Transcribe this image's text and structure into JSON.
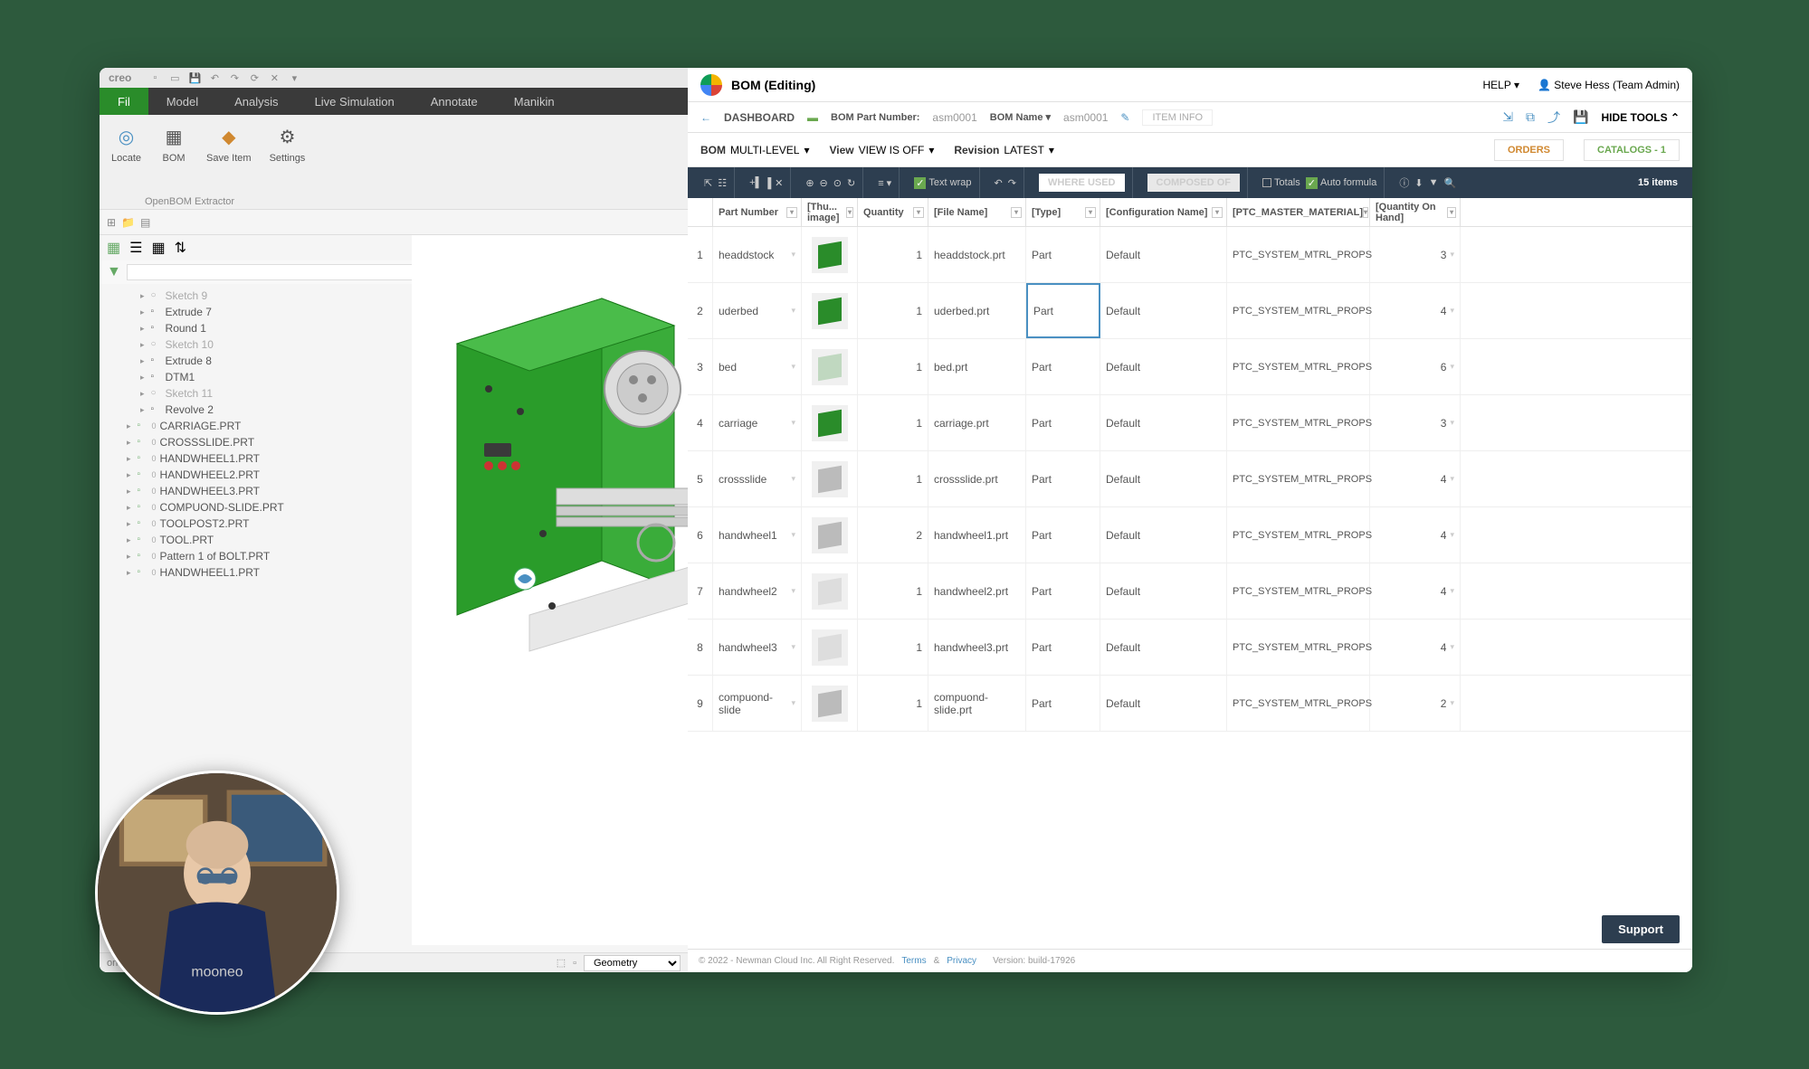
{
  "creo": {
    "logo": "creo",
    "tabs": [
      "Fil",
      "Model",
      "Analysis",
      "Live Simulation",
      "Annotate",
      "Manikin"
    ],
    "active_tab": 0,
    "ribbon": [
      {
        "label": "Locate",
        "icon": "◎"
      },
      {
        "label": "BOM",
        "icon": "▦"
      },
      {
        "label": "Save Item",
        "icon": "◆"
      },
      {
        "label": "Settings",
        "icon": "⚙"
      }
    ],
    "ribbon_group": "OpenBOM Extractor",
    "tree_features": [
      {
        "label": "Sketch 9",
        "type": "sketch"
      },
      {
        "label": "Extrude 7",
        "type": "feature"
      },
      {
        "label": "Round 1",
        "type": "feature"
      },
      {
        "label": "Sketch 10",
        "type": "sketch"
      },
      {
        "label": "Extrude 8",
        "type": "feature"
      },
      {
        "label": "DTM1",
        "type": "feature"
      },
      {
        "label": "Sketch 11",
        "type": "sketch"
      },
      {
        "label": "Revolve 2",
        "type": "feature"
      }
    ],
    "tree_parts": [
      "CARRIAGE.PRT",
      "CROSSSLIDE.PRT",
      "HANDWHEEL1.PRT",
      "HANDWHEEL2.PRT",
      "HANDWHEEL3.PRT",
      "COMPUOND-SLIDE.PRT",
      "TOOLPOST2.PRT",
      "TOOL.PRT",
      "Pattern 1 of BOLT.PRT",
      "HANDWHEEL1.PRT"
    ],
    "status": "on saved",
    "geometry": "Geometry"
  },
  "openbom": {
    "title": "BOM (Editing)",
    "help": "HELP",
    "user": "Steve Hess (Team Admin)",
    "dashboard": "DASHBOARD",
    "bom_pn_label": "BOM Part Number:",
    "bom_pn_value": "asm0001",
    "bom_name_label": "BOM Name",
    "bom_name_value": "asm0001",
    "item_info": "ITEM INFO",
    "hide_tools": "HIDE TOOLS",
    "bom_label": "BOM",
    "multi_level": "MULTI-LEVEL",
    "view_label": "View",
    "view_is_off": "VIEW IS OFF",
    "revision_label": "Revision",
    "latest": "LATEST",
    "orders": "ORDERS",
    "catalogs": "CATALOGS - 1",
    "text_wrap": "Text wrap",
    "where_used": "WHERE USED",
    "composed_of": "COMPOSED OF",
    "totals": "Totals",
    "auto_formula": "Auto formula",
    "items_count": "15 items",
    "columns": [
      "Part Number",
      "[Thu... image]",
      "Quantity",
      "[File Name]",
      "[Type]",
      "[Configuration Name]",
      "[PTC_MASTER_MATERIAL]",
      "[Quantity On Hand]"
    ],
    "rows": [
      {
        "idx": "1",
        "pn": "headdstock",
        "qty": "1",
        "fn": "headdstock.prt",
        "type": "Part",
        "cfg": "Default",
        "mat": "PTC_SYSTEM_MTRL_PROPS",
        "qoh": "3",
        "thumb_color": "#2a8c2a"
      },
      {
        "idx": "2",
        "pn": "uderbed",
        "qty": "1",
        "fn": "uderbed.prt",
        "type": "Part",
        "cfg": "Default",
        "mat": "PTC_SYSTEM_MTRL_PROPS",
        "qoh": "4",
        "thumb_color": "#2a8c2a",
        "selected_col": "type"
      },
      {
        "idx": "3",
        "pn": "bed",
        "qty": "1",
        "fn": "bed.prt",
        "type": "Part",
        "cfg": "Default",
        "mat": "PTC_SYSTEM_MTRL_PROPS",
        "qoh": "6",
        "thumb_color": "#c0d8c0"
      },
      {
        "idx": "4",
        "pn": "carriage",
        "qty": "1",
        "fn": "carriage.prt",
        "type": "Part",
        "cfg": "Default",
        "mat": "PTC_SYSTEM_MTRL_PROPS",
        "qoh": "3",
        "thumb_color": "#2a8c2a"
      },
      {
        "idx": "5",
        "pn": "crossslide",
        "qty": "1",
        "fn": "crossslide.prt",
        "type": "Part",
        "cfg": "Default",
        "mat": "PTC_SYSTEM_MTRL_PROPS",
        "qoh": "4",
        "thumb_color": "#bbb"
      },
      {
        "idx": "6",
        "pn": "handwheel1",
        "qty": "2",
        "fn": "handwheel1.prt",
        "type": "Part",
        "cfg": "Default",
        "mat": "PTC_SYSTEM_MTRL_PROPS",
        "qoh": "4",
        "thumb_color": "#bbb"
      },
      {
        "idx": "7",
        "pn": "handwheel2",
        "qty": "1",
        "fn": "handwheel2.prt",
        "type": "Part",
        "cfg": "Default",
        "mat": "PTC_SYSTEM_MTRL_PROPS",
        "qoh": "4",
        "thumb_color": "#ddd"
      },
      {
        "idx": "8",
        "pn": "handwheel3",
        "qty": "1",
        "fn": "handwheel3.prt",
        "type": "Part",
        "cfg": "Default",
        "mat": "PTC_SYSTEM_MTRL_PROPS",
        "qoh": "4",
        "thumb_color": "#ddd"
      },
      {
        "idx": "9",
        "pn": "compuond-slide",
        "qty": "1",
        "fn": "compuond-slide.prt",
        "type": "Part",
        "cfg": "Default",
        "mat": "PTC_SYSTEM_MTRL_PROPS",
        "qoh": "2",
        "thumb_color": "#bbb"
      }
    ],
    "footer_copy": "© 2022 - Newman Cloud Inc. All Right Reserved.",
    "footer_terms": "Terms",
    "footer_amp": "&",
    "footer_privacy": "Privacy",
    "footer_version": "Version: build-17926",
    "support": "Support"
  }
}
